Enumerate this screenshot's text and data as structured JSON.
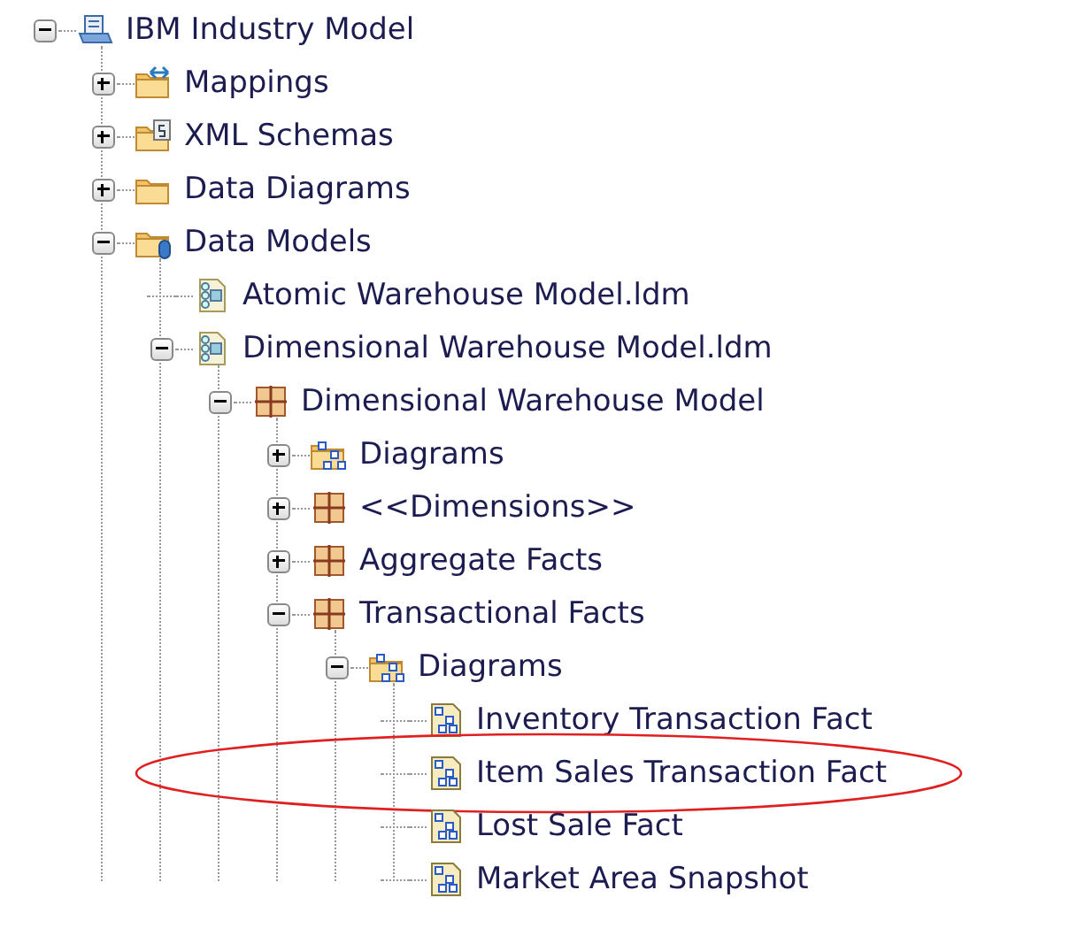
{
  "tree": [
    {
      "label": "IBM Industry Model",
      "kind": "project",
      "expanded": true,
      "children": [
        {
          "label": "Mappings",
          "kind": "mapping-folder",
          "expanded": false
        },
        {
          "label": "XML Schemas",
          "kind": "schema-folder",
          "expanded": false
        },
        {
          "label": "Data Diagrams",
          "kind": "folder",
          "expanded": false
        },
        {
          "label": "Data Models",
          "kind": "db-folder",
          "expanded": true,
          "children": [
            {
              "label": "Atomic Warehouse Model.ldm",
              "kind": "model-file"
            },
            {
              "label": "Dimensional Warehouse Model.ldm",
              "kind": "model-file",
              "expanded": true,
              "children": [
                {
                  "label": "Dimensional Warehouse Model",
                  "kind": "package",
                  "expanded": true,
                  "children": [
                    {
                      "label": "Diagrams",
                      "kind": "diagram-folder",
                      "expanded": false
                    },
                    {
                      "label": "<<Dimensions>>",
                      "kind": "package",
                      "expanded": false
                    },
                    {
                      "label": "Aggregate Facts",
                      "kind": "package",
                      "expanded": false
                    },
                    {
                      "label": "Transactional Facts",
                      "kind": "package",
                      "expanded": true,
                      "children": [
                        {
                          "label": "Diagrams",
                          "kind": "diagram-folder",
                          "expanded": true,
                          "children": [
                            {
                              "label": "Inventory Transaction Fact",
                              "kind": "diagram",
                              "highlighted": false
                            },
                            {
                              "label": "Item Sales Transaction Fact",
                              "kind": "diagram",
                              "highlighted": true
                            },
                            {
                              "label": "Lost Sale Fact",
                              "kind": "diagram",
                              "highlighted": false
                            },
                            {
                              "label": "Market Area Snapshot",
                              "kind": "diagram",
                              "highlighted": false
                            }
                          ]
                        }
                      ]
                    }
                  ]
                }
              ]
            }
          ]
        }
      ]
    }
  ]
}
